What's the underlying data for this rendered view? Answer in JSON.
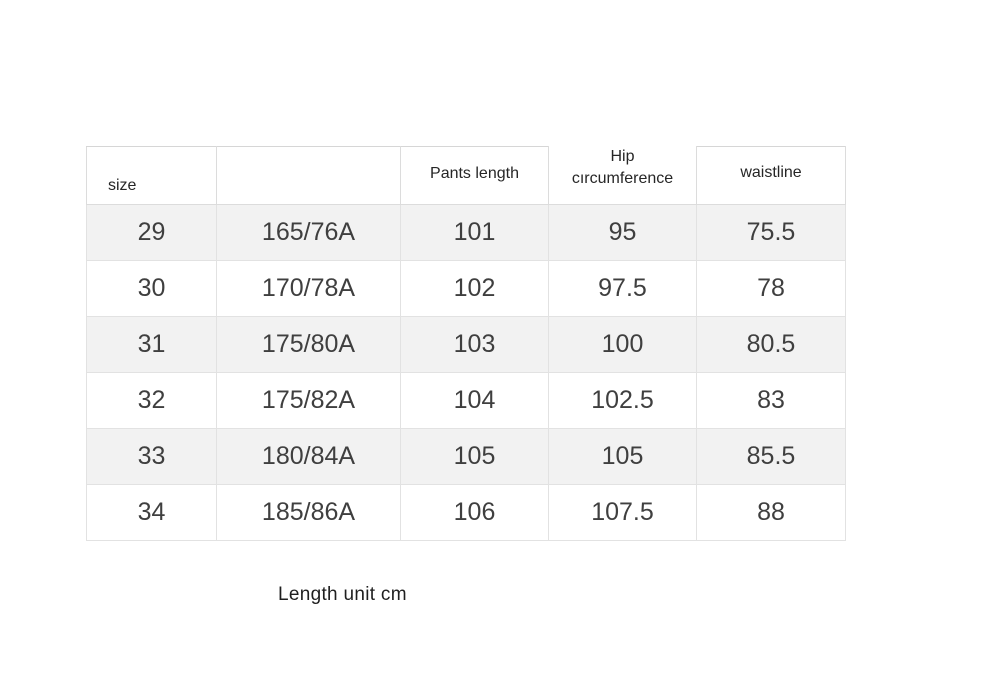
{
  "table": {
    "headers": [
      "size",
      "",
      "Pants length",
      "Hip circumference",
      "waistline"
    ],
    "header_hip_line1": "Hip",
    "header_hip_line2": "cırcumference",
    "rows": [
      {
        "size": "29",
        "height_weight": "165/76A",
        "pants_length": "101",
        "hip_circumference": "95",
        "waistline": "75.5"
      },
      {
        "size": "30",
        "height_weight": "170/78A",
        "pants_length": "102",
        "hip_circumference": "97.5",
        "waistline": "78"
      },
      {
        "size": "31",
        "height_weight": "175/80A",
        "pants_length": "103",
        "hip_circumference": "100",
        "waistline": "80.5"
      },
      {
        "size": "32",
        "height_weight": "175/82A",
        "pants_length": "104",
        "hip_circumference": "102.5",
        "waistline": "83"
      },
      {
        "size": "33",
        "height_weight": "180/84A",
        "pants_length": "105",
        "hip_circumference": "105",
        "waistline": "85.5"
      },
      {
        "size": "34",
        "height_weight": "185/86A",
        "pants_length": "106",
        "hip_circumference": "107.5",
        "waistline": "88"
      }
    ]
  },
  "footer": {
    "note": "Length unit cm"
  },
  "colors": {
    "background": "#ffffff",
    "stripe": "#f2f2f2",
    "border": "#e2e2e2",
    "header_text": "#262626",
    "cell_text": "#3f3f3f"
  }
}
